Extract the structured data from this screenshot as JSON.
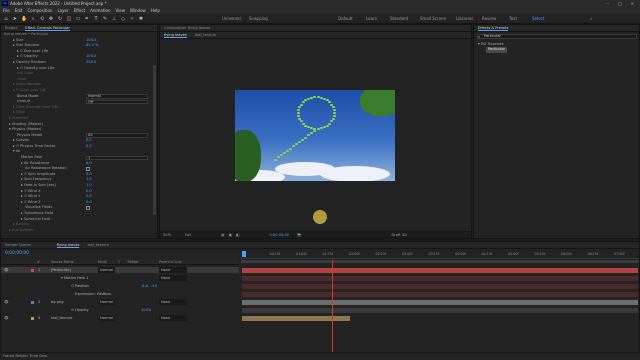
{
  "window": {
    "title": "Adobe After Effects 2022 - Untitled Project.aep *",
    "app_badge": "Ae",
    "controls": [
      "–",
      "□",
      "✕"
    ]
  },
  "menu": [
    "File",
    "Edit",
    "Composition",
    "Layer",
    "Effect",
    "Animation",
    "View",
    "Window",
    "Help"
  ],
  "toolbar": {
    "tools": [
      "home-icon",
      "selection-icon",
      "hand-icon",
      "zoom-icon",
      "orbit-icon",
      "move-icon",
      "rotate-icon",
      "camera-icon",
      "rectangle-icon",
      "pen-icon",
      "text-icon",
      "brush-icon",
      "stamp-icon",
      "eraser-icon",
      "roto-icon",
      "puppet-icon"
    ],
    "universal": "Universal",
    "snapping": "Snapping",
    "workspaces": [
      "Default",
      "Learn",
      "Standard",
      "Small Screen",
      "Libraries",
      "Review",
      "Text",
      "Select"
    ],
    "active_workspace": "Select"
  },
  "left_panel": {
    "tabs": [
      "Project",
      "Effect Controls Particular"
    ],
    "layer_path": "flying leaves • Particular",
    "rows": [
      {
        "label": "▸ Size",
        "value": "100.0",
        "indent": 12
      },
      {
        "label": "▸ Size Random",
        "value": "85.0 %",
        "indent": 12
      },
      {
        "label": "▸ ⏱ Size over Life",
        "value": "",
        "indent": 16
      },
      {
        "label": "▸ ⏱ Opacity",
        "value": "100.0",
        "indent": 16
      },
      {
        "label": "▸ Opacity Random",
        "value": "100.0",
        "indent": 12
      },
      {
        "label": "▸ ⏱ Opacity over Life",
        "value": "",
        "indent": 16
      },
      {
        "label": "Set Color",
        "value": "",
        "indent": 16,
        "dim": true
      },
      {
        "label": "Color",
        "value": "",
        "indent": 16,
        "dim": true
      },
      {
        "label": "▸ Color Random",
        "value": "",
        "indent": 12,
        "dim": true
      },
      {
        "label": "▸ ⏱ Color over Life",
        "value": "",
        "indent": 12,
        "dim": true
      },
      {
        "label": "Blend Mode",
        "dropdown": "Normal",
        "indent": 16
      },
      {
        "label": "Unmult",
        "dropdown": "Off",
        "indent": 16
      },
      {
        "label": "▸ Glow Strength over Life",
        "value": "",
        "indent": 12,
        "dim": true
      },
      {
        "label": "▸ Glow",
        "value": "",
        "indent": 12,
        "dim": true
      },
      {
        "label": "▸ Streaklet",
        "value": "",
        "indent": 8,
        "dim": true
      },
      {
        "label": "▸ Shading (Master)",
        "value": "",
        "indent": 8
      },
      {
        "label": "▾ Physics (Master)",
        "value": "",
        "indent": 8
      },
      {
        "label": "Physics Model",
        "dropdown": "Air",
        "indent": 16
      },
      {
        "label": "▸ Gravity",
        "value": "0.0",
        "indent": 12
      },
      {
        "label": "▸ ⏱ Physics Time Factor",
        "value": "0.0",
        "indent": 12
      },
      {
        "label": "▾ Air",
        "value": "",
        "indent": 12
      },
      {
        "label": "Motion Path",
        "dropdown": "1",
        "indent": 20
      },
      {
        "label": "▸ Air Resistance",
        "value": "0.0",
        "indent": 20
      },
      {
        "label": "Air Resistance Rotation",
        "check": true,
        "indent": 24
      },
      {
        "label": "▸ ⏱ Spin Amplitude",
        "value": "0.0",
        "indent": 20
      },
      {
        "label": "▸ Spin Frequency",
        "value": "1.0",
        "indent": 20
      },
      {
        "label": "▸ Fade-in Spin [sec]",
        "value": "1.0",
        "indent": 20
      },
      {
        "label": "▸ ⏱ Wind X",
        "value": "0.0",
        "indent": 20
      },
      {
        "label": "▸ ⏱ Wind Y",
        "value": "0.0",
        "indent": 20
      },
      {
        "label": "▸ ⏱ Wind Z",
        "value": "0.0",
        "indent": 20
      },
      {
        "label": "Visualize Fields",
        "check": true,
        "indent": 24
      },
      {
        "label": "▸ Turbulence Field",
        "value": "",
        "indent": 20
      },
      {
        "label": "▸ Spherical Field",
        "value": "",
        "indent": 20
      },
      {
        "label": "▸ Bounce",
        "value": "",
        "indent": 12,
        "dim": true
      },
      {
        "label": "▸ Aux System",
        "value": "",
        "indent": 8,
        "dim": true
      }
    ]
  },
  "comp_panel": {
    "header": "Composition flying leaves",
    "tabs": [
      "flying leaves",
      "leaf_texture"
    ],
    "viewer_bar": {
      "zoom": "50%",
      "quality": "Full",
      "timecode": "0;00;00;00",
      "camera": "Draft 3D"
    }
  },
  "right_panel": {
    "tabs": [
      "Effects & Presets"
    ],
    "search_value": "Particular",
    "tree": [
      {
        "label": "▾ RG Trapcode"
      },
      {
        "label": "Particular",
        "selected": true
      }
    ]
  },
  "timeline": {
    "tabs": [
      "Render Queue",
      "flying leaves",
      "leaf_texture"
    ],
    "current_time": "0;00;00;00",
    "columns": [
      "#",
      "Source Name",
      "Mode",
      "T",
      "TrkMat",
      "Parent & Link"
    ],
    "ruler": [
      "0f",
      "00:15f",
      "01:00f",
      "01:15f",
      "02:00f",
      "02:15f",
      "03:00f",
      "03:15f",
      "04:00f",
      "04:15f",
      "05:00f",
      "05:15f",
      "06:00f",
      "06:15f",
      "07:00f"
    ],
    "layers": [
      {
        "num": "1",
        "name": "[Particular]",
        "mode": "Normal",
        "parent": "None",
        "color": "#d04a4a",
        "selected": true
      },
      {
        "num": "",
        "name": "▾ Motion Path 1",
        "mode": "",
        "parent": "None",
        "color": "",
        "indent": 10
      },
      {
        "num": "",
        "name": "⏱ Position",
        "mode": "",
        "parent": "",
        "color": "",
        "indent": 20,
        "value": "-6.6, -4.0"
      },
      {
        "num": "",
        "name": "Expression: Position",
        "mode": "",
        "parent": "",
        "color": "",
        "indent": 24
      },
      {
        "num": "2",
        "name": "bg.png",
        "mode": "Normal",
        "parent": "None",
        "color": "#5e7fb8"
      },
      {
        "num": "",
        "name": "⏱ Opacity",
        "mode": "",
        "parent": "",
        "color": "",
        "indent": 20,
        "value": "100%"
      },
      {
        "num": "3",
        "name": "leaf_texture",
        "mode": "Normal",
        "parent": "None",
        "color": "#b8a15e"
      }
    ]
  },
  "status": {
    "text": "Frame Render Time  0ms"
  },
  "colors": {
    "accent": "#4aa3ff",
    "track_red": "#b54343",
    "track_gray": "#6e6e6e",
    "playhead": "#d33"
  }
}
